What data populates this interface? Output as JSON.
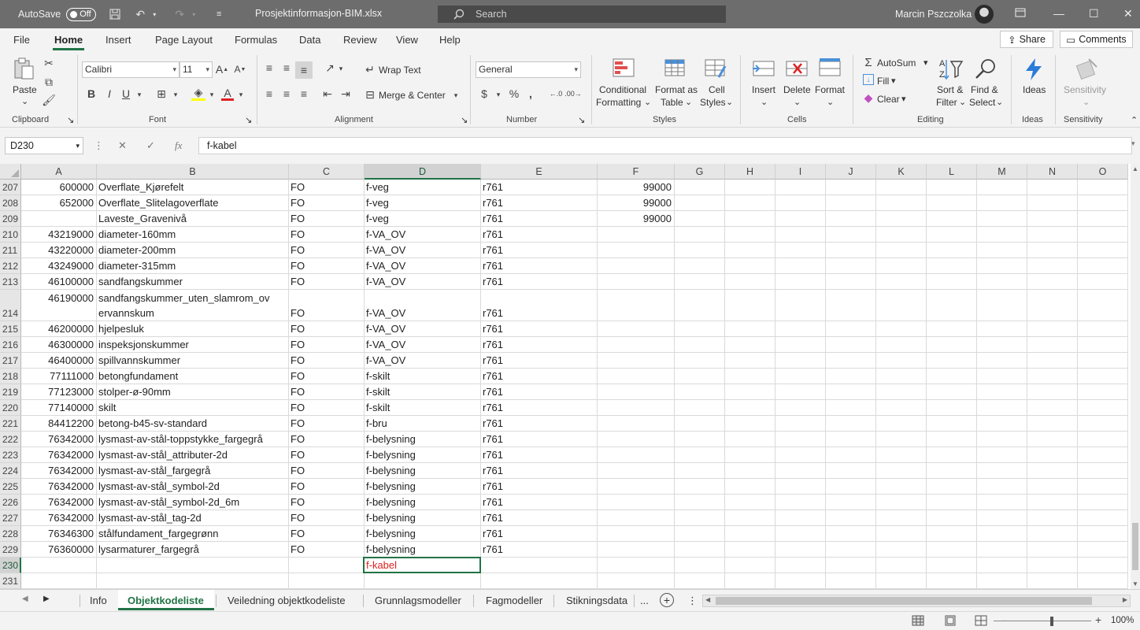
{
  "titlebar": {
    "autosave_label": "AutoSave",
    "autosave_state": "Off",
    "filename": "Prosjektinformasjon-BIM.xlsx",
    "search_placeholder": "Search",
    "user": "Marcin Pszczolka"
  },
  "ribbon_tabs": [
    "File",
    "Home",
    "Insert",
    "Page Layout",
    "Formulas",
    "Data",
    "Review",
    "View",
    "Help"
  ],
  "active_ribbon_tab": "Home",
  "share_label": "Share",
  "comments_label": "Comments",
  "ribbon": {
    "clipboard": {
      "paste": "Paste",
      "label": "Clipboard"
    },
    "font": {
      "name": "Calibri",
      "size": "11",
      "label": "Font"
    },
    "alignment": {
      "wrap": "Wrap Text",
      "merge": "Merge & Center",
      "label": "Alignment"
    },
    "number": {
      "format": "General",
      "label": "Number"
    },
    "styles": {
      "cond1": "Conditional",
      "cond2": "Formatting",
      "fmt1": "Format as",
      "fmt2": "Table",
      "cell1": "Cell",
      "cell2": "Styles",
      "label": "Styles"
    },
    "cells": {
      "insert": "Insert",
      "delete": "Delete",
      "format": "Format",
      "label": "Cells"
    },
    "editing": {
      "autosum": "AutoSum",
      "fill": "Fill",
      "clear": "Clear",
      "sort1": "Sort &",
      "sort2": "Filter",
      "find1": "Find &",
      "find2": "Select",
      "label": "Editing"
    },
    "ideas": {
      "button": "Ideas",
      "label": "Ideas"
    },
    "sensitivity": {
      "button": "Sensitivity",
      "label": "Sensitivity"
    }
  },
  "formula_bar": {
    "cell_ref": "D230",
    "formula": "f-kabel"
  },
  "columns": [
    "A",
    "B",
    "C",
    "D",
    "E",
    "F",
    "G",
    "H",
    "I",
    "J",
    "K",
    "L",
    "M",
    "N",
    "O"
  ],
  "selected_column": "D",
  "selected_row": "230",
  "rows": [
    {
      "num": "207",
      "a": "600000",
      "b": "Overflate_Kjørefelt",
      "c": "FO",
      "d": "f-veg",
      "e": "r761",
      "f": "99000"
    },
    {
      "num": "208",
      "a": "652000",
      "b": "Overflate_Slitelagoverflate",
      "c": "FO",
      "d": "f-veg",
      "e": "r761",
      "f": "99000"
    },
    {
      "num": "209",
      "a": "",
      "b": "Laveste_Gravenivå",
      "c": "FO",
      "d": "f-veg",
      "e": "r761",
      "f": "99000"
    },
    {
      "num": "210",
      "a": "43219000",
      "b": "diameter-160mm",
      "c": "FO",
      "d": "f-VA_OV",
      "e": "r761",
      "f": ""
    },
    {
      "num": "211",
      "a": "43220000",
      "b": "diameter-200mm",
      "c": "FO",
      "d": "f-VA_OV",
      "e": "r761",
      "f": ""
    },
    {
      "num": "212",
      "a": "43249000",
      "b": "diameter-315mm",
      "c": "FO",
      "d": "f-VA_OV",
      "e": "r761",
      "f": ""
    },
    {
      "num": "213",
      "a": "46100000",
      "b": "sandfangskummer",
      "c": "FO",
      "d": "f-VA_OV",
      "e": "r761",
      "f": ""
    },
    {
      "num": "214",
      "a": "46190000",
      "b": "sandfangskummer_uten_slamrom_ov",
      "b2": "ervannskum",
      "c": "FO",
      "d": "f-VA_OV",
      "e": "r761",
      "f": ""
    },
    {
      "num": "215",
      "a": "46200000",
      "b": "hjelpesluk",
      "c": "FO",
      "d": "f-VA_OV",
      "e": "r761",
      "f": ""
    },
    {
      "num": "216",
      "a": "46300000",
      "b": "inspeksjonskummer",
      "c": "FO",
      "d": "f-VA_OV",
      "e": "r761",
      "f": ""
    },
    {
      "num": "217",
      "a": "46400000",
      "b": "spillvannskummer",
      "c": "FO",
      "d": "f-VA_OV",
      "e": "r761",
      "f": ""
    },
    {
      "num": "218",
      "a": "77111000",
      "b": "betongfundament",
      "c": "FO",
      "d": "f-skilt",
      "e": "r761",
      "f": ""
    },
    {
      "num": "219",
      "a": "77123000",
      "b": "stolper-ø-90mm",
      "c": "FO",
      "d": "f-skilt",
      "e": "r761",
      "f": ""
    },
    {
      "num": "220",
      "a": "77140000",
      "b": "skilt",
      "c": "FO",
      "d": "f-skilt",
      "e": "r761",
      "f": ""
    },
    {
      "num": "221",
      "a": "84412200",
      "b": "betong-b45-sv-standard",
      "c": "FO",
      "d": "f-bru",
      "e": "r761",
      "f": ""
    },
    {
      "num": "222",
      "a": "76342000",
      "b": "lysmast-av-stål-toppstykke_fargegrå",
      "c": "FO",
      "d": "f-belysning",
      "e": "r761",
      "f": ""
    },
    {
      "num": "223",
      "a": "76342000",
      "b": "lysmast-av-stål_attributer-2d",
      "c": "FO",
      "d": "f-belysning",
      "e": "r761",
      "f": ""
    },
    {
      "num": "224",
      "a": "76342000",
      "b": "lysmast-av-stål_fargegrå",
      "c": "FO",
      "d": "f-belysning",
      "e": "r761",
      "f": ""
    },
    {
      "num": "225",
      "a": "76342000",
      "b": "lysmast-av-stål_symbol-2d",
      "c": "FO",
      "d": "f-belysning",
      "e": "r761",
      "f": ""
    },
    {
      "num": "226",
      "a": "76342000",
      "b": "lysmast-av-stål_symbol-2d_6m",
      "c": "FO",
      "d": "f-belysning",
      "e": "r761",
      "f": ""
    },
    {
      "num": "227",
      "a": "76342000",
      "b": "lysmast-av-stål_tag-2d",
      "c": "FO",
      "d": "f-belysning",
      "e": "r761",
      "f": ""
    },
    {
      "num": "228",
      "a": "76346300",
      "b": "stålfundament_fargegrønn",
      "c": "FO",
      "d": "f-belysning",
      "e": "r761",
      "f": ""
    },
    {
      "num": "229",
      "a": "76360000",
      "b": "lysarmaturer_fargegrå",
      "c": "FO",
      "d": "f-belysning",
      "e": "r761",
      "f": ""
    },
    {
      "num": "230",
      "a": "",
      "b": "",
      "c": "",
      "d": "f-kabel",
      "e": "",
      "f": ""
    },
    {
      "num": "231",
      "a": "",
      "b": "",
      "c": "",
      "d": "",
      "e": "",
      "f": ""
    }
  ],
  "sheets": [
    "Info",
    "Objektkodeliste",
    "Veiledning objektkodeliste",
    "Grunnlagsmodeller",
    "Fagmodeller",
    "Stikningsdata"
  ],
  "active_sheet": "Objektkodeliste",
  "sheets_more": "...",
  "zoom": "100%",
  "colors": {
    "accent": "#217346",
    "titlebar": "#6d6d6d",
    "red_text": "#e02020"
  }
}
